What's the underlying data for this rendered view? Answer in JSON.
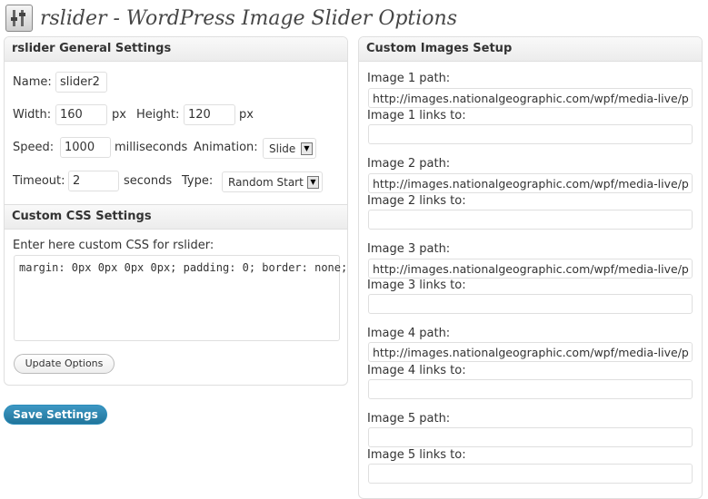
{
  "page": {
    "title": "rslider - WordPress Image Slider Options",
    "icon": "settings-icon"
  },
  "general": {
    "header": "rslider General Settings",
    "name_label": "Name:",
    "name_value": "slider2",
    "width_label": "Width:",
    "width_value": "160",
    "width_unit": "px",
    "height_label": "Height:",
    "height_value": "120",
    "height_unit": "px",
    "speed_label": "Speed:",
    "speed_value": "1000",
    "speed_unit": "milliseconds",
    "animation_label": "Animation:",
    "animation_value": "Slide",
    "timeout_label": "Timeout:",
    "timeout_value": "2",
    "timeout_unit": "seconds",
    "type_label": "Type:",
    "type_value": "Random Start"
  },
  "css": {
    "header": "Custom CSS Settings",
    "label": "Enter here custom CSS for rslider:",
    "value": "margin: 0px 0px 0px 0px; padding: 0; border: none;",
    "update_button": "Update Options"
  },
  "save_button": "Save Settings",
  "images": {
    "header": "Custom Images Setup",
    "items": [
      {
        "path_label": "Image 1 path:",
        "path_value": "http://images.nationalgeographic.com/wpf/media-live/p",
        "link_label": "Image 1 links to:",
        "link_value": ""
      },
      {
        "path_label": "Image 2 path:",
        "path_value": "http://images.nationalgeographic.com/wpf/media-live/p",
        "link_label": "Image 2 links to:",
        "link_value": ""
      },
      {
        "path_label": "Image 3 path:",
        "path_value": "http://images.nationalgeographic.com/wpf/media-live/p",
        "link_label": "Image 3 links to:",
        "link_value": ""
      },
      {
        "path_label": "Image 4 path:",
        "path_value": "http://images.nationalgeographic.com/wpf/media-live/p",
        "link_label": "Image 4 links to:",
        "link_value": ""
      },
      {
        "path_label": "Image 5 path:",
        "path_value": "",
        "link_label": "Image 5 links to:",
        "link_value": ""
      }
    ]
  },
  "colors": {
    "primary_button": "#21759b",
    "box_border": "#dfdfdf"
  }
}
